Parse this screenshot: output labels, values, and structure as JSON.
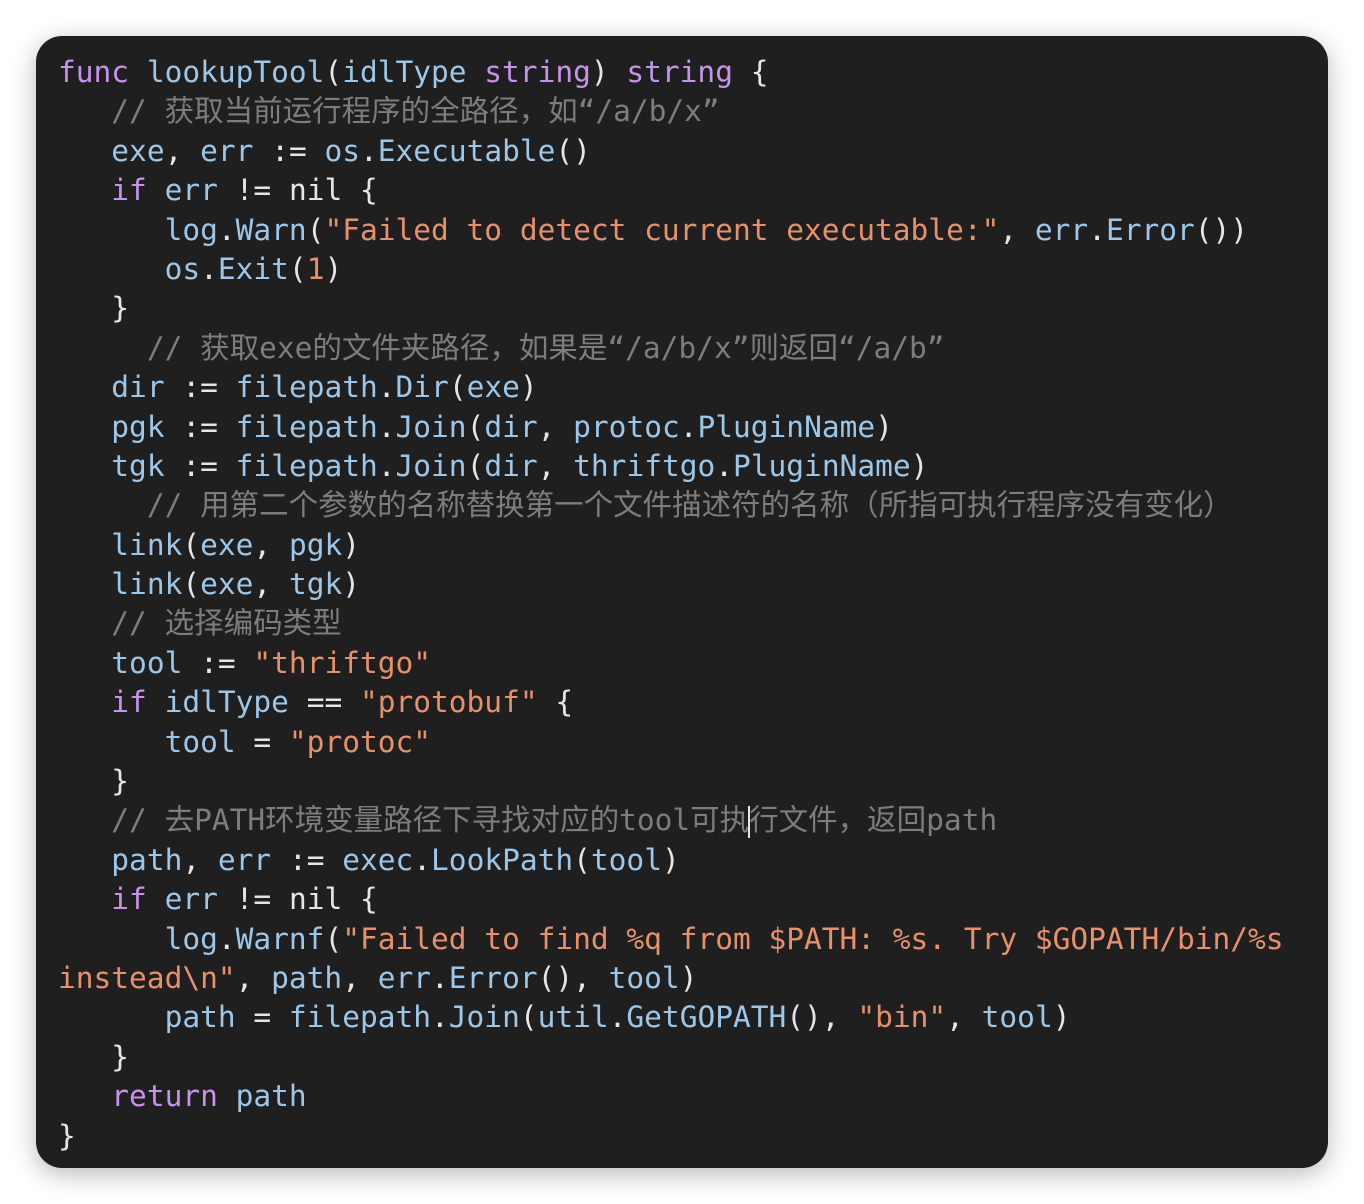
{
  "colors": {
    "background": "#1f1f1f",
    "keyword": "#c792ea",
    "identifier": "#9cc7e8",
    "string": "#e8906b",
    "comment": "#7d7d7d",
    "punctuation": "#e6e6e6"
  },
  "code": {
    "lines": [
      [
        [
          "kw",
          "func"
        ],
        [
          "pn",
          " "
        ],
        [
          "fn",
          "lookupTool"
        ],
        [
          "pn",
          "("
        ],
        [
          "id",
          "idlType"
        ],
        [
          "pn",
          " "
        ],
        [
          "ty",
          "string"
        ],
        [
          "pn",
          ") "
        ],
        [
          "ty",
          "string"
        ],
        [
          "pn",
          " {"
        ]
      ],
      [
        [
          "pn",
          "   "
        ],
        [
          "cm",
          "// 获取当前运行程序的全路径，如“/a/b/x”"
        ]
      ],
      [
        [
          "pn",
          "   "
        ],
        [
          "id",
          "exe"
        ],
        [
          "pn",
          ", "
        ],
        [
          "id",
          "err"
        ],
        [
          "pn",
          " "
        ],
        [
          "op",
          ":="
        ],
        [
          "pn",
          " "
        ],
        [
          "id",
          "os"
        ],
        [
          "pn",
          "."
        ],
        [
          "fn",
          "Executable"
        ],
        [
          "pn",
          "()"
        ]
      ],
      [
        [
          "pn",
          "   "
        ],
        [
          "kw",
          "if"
        ],
        [
          "pn",
          " "
        ],
        [
          "id",
          "err"
        ],
        [
          "pn",
          " "
        ],
        [
          "op",
          "!="
        ],
        [
          "pn",
          " nil {"
        ]
      ],
      [
        [
          "pn",
          "      "
        ],
        [
          "id",
          "log"
        ],
        [
          "pn",
          "."
        ],
        [
          "fn",
          "Warn"
        ],
        [
          "pn",
          "("
        ],
        [
          "str",
          "\"Failed to detect current executable:\""
        ],
        [
          "pn",
          ", "
        ],
        [
          "id",
          "err"
        ],
        [
          "pn",
          "."
        ],
        [
          "fn",
          "Error"
        ],
        [
          "pn",
          "())"
        ]
      ],
      [
        [
          "pn",
          "      "
        ],
        [
          "id",
          "os"
        ],
        [
          "pn",
          "."
        ],
        [
          "fn",
          "Exit"
        ],
        [
          "pn",
          "("
        ],
        [
          "num",
          "1"
        ],
        [
          "pn",
          ")"
        ]
      ],
      [
        [
          "pn",
          "   }"
        ]
      ],
      [
        [
          "pn",
          "     "
        ],
        [
          "cm",
          "// 获取exe的文件夹路径，如果是“/a/b/x”则返回“/a/b”"
        ]
      ],
      [
        [
          "pn",
          "   "
        ],
        [
          "id",
          "dir"
        ],
        [
          "pn",
          " "
        ],
        [
          "op",
          ":="
        ],
        [
          "pn",
          " "
        ],
        [
          "id",
          "filepath"
        ],
        [
          "pn",
          "."
        ],
        [
          "fn",
          "Dir"
        ],
        [
          "pn",
          "("
        ],
        [
          "id",
          "exe"
        ],
        [
          "pn",
          ")"
        ]
      ],
      [
        [
          "pn",
          "   "
        ],
        [
          "id",
          "pgk"
        ],
        [
          "pn",
          " "
        ],
        [
          "op",
          ":="
        ],
        [
          "pn",
          " "
        ],
        [
          "id",
          "filepath"
        ],
        [
          "pn",
          "."
        ],
        [
          "fn",
          "Join"
        ],
        [
          "pn",
          "("
        ],
        [
          "id",
          "dir"
        ],
        [
          "pn",
          ", "
        ],
        [
          "id",
          "protoc"
        ],
        [
          "pn",
          "."
        ],
        [
          "id",
          "PluginName"
        ],
        [
          "pn",
          ")"
        ]
      ],
      [
        [
          "pn",
          "   "
        ],
        [
          "id",
          "tgk"
        ],
        [
          "pn",
          " "
        ],
        [
          "op",
          ":="
        ],
        [
          "pn",
          " "
        ],
        [
          "id",
          "filepath"
        ],
        [
          "pn",
          "."
        ],
        [
          "fn",
          "Join"
        ],
        [
          "pn",
          "("
        ],
        [
          "id",
          "dir"
        ],
        [
          "pn",
          ", "
        ],
        [
          "id",
          "thriftgo"
        ],
        [
          "pn",
          "."
        ],
        [
          "id",
          "PluginName"
        ],
        [
          "pn",
          ")"
        ]
      ],
      [
        [
          "pn",
          "     "
        ],
        [
          "cm",
          "// 用第二个参数的名称替换第一个文件描述符的名称（所指可执行程序没有变化）"
        ]
      ],
      [
        [
          "pn",
          "   "
        ],
        [
          "fn",
          "link"
        ],
        [
          "pn",
          "("
        ],
        [
          "id",
          "exe"
        ],
        [
          "pn",
          ", "
        ],
        [
          "id",
          "pgk"
        ],
        [
          "pn",
          ")"
        ]
      ],
      [
        [
          "pn",
          "   "
        ],
        [
          "fn",
          "link"
        ],
        [
          "pn",
          "("
        ],
        [
          "id",
          "exe"
        ],
        [
          "pn",
          ", "
        ],
        [
          "id",
          "tgk"
        ],
        [
          "pn",
          ")"
        ]
      ],
      [
        [
          "pn",
          "   "
        ],
        [
          "cm",
          "// 选择编码类型"
        ]
      ],
      [
        [
          "pn",
          "   "
        ],
        [
          "id",
          "tool"
        ],
        [
          "pn",
          " "
        ],
        [
          "op",
          ":="
        ],
        [
          "pn",
          " "
        ],
        [
          "str",
          "\"thriftgo\""
        ]
      ],
      [
        [
          "pn",
          "   "
        ],
        [
          "kw",
          "if"
        ],
        [
          "pn",
          " "
        ],
        [
          "id",
          "idlType"
        ],
        [
          "pn",
          " "
        ],
        [
          "op",
          "=="
        ],
        [
          "pn",
          " "
        ],
        [
          "str",
          "\"protobuf\""
        ],
        [
          "pn",
          " {"
        ]
      ],
      [
        [
          "pn",
          "      "
        ],
        [
          "id",
          "tool"
        ],
        [
          "pn",
          " "
        ],
        [
          "op",
          "="
        ],
        [
          "pn",
          " "
        ],
        [
          "str",
          "\"protoc\""
        ]
      ],
      [
        [
          "pn",
          "   }"
        ]
      ],
      [
        [
          "pn",
          "   "
        ],
        [
          "cm",
          "// 去PATH环境变量路径下寻找对应的tool可执"
        ],
        [
          "cursor",
          ""
        ],
        [
          "cm",
          "行文件，返回path"
        ]
      ],
      [
        [
          "pn",
          "   "
        ],
        [
          "id",
          "path"
        ],
        [
          "pn",
          ", "
        ],
        [
          "id",
          "err"
        ],
        [
          "pn",
          " "
        ],
        [
          "op",
          ":="
        ],
        [
          "pn",
          " "
        ],
        [
          "id",
          "exec"
        ],
        [
          "pn",
          "."
        ],
        [
          "fn",
          "LookPath"
        ],
        [
          "pn",
          "("
        ],
        [
          "id",
          "tool"
        ],
        [
          "pn",
          ")"
        ]
      ],
      [
        [
          "pn",
          "   "
        ],
        [
          "kw",
          "if"
        ],
        [
          "pn",
          " "
        ],
        [
          "id",
          "err"
        ],
        [
          "pn",
          " "
        ],
        [
          "op",
          "!="
        ],
        [
          "pn",
          " nil {"
        ]
      ],
      [
        [
          "pn",
          "      "
        ],
        [
          "id",
          "log"
        ],
        [
          "pn",
          "."
        ],
        [
          "fn",
          "Warnf"
        ],
        [
          "pn",
          "("
        ],
        [
          "str",
          "\"Failed to find %q from $PATH: %s. Try $GOPATH/bin/%s"
        ]
      ],
      [
        [
          "str",
          "instead\\n\""
        ],
        [
          "pn",
          ", "
        ],
        [
          "id",
          "path"
        ],
        [
          "pn",
          ", "
        ],
        [
          "id",
          "err"
        ],
        [
          "pn",
          "."
        ],
        [
          "fn",
          "Error"
        ],
        [
          "pn",
          "(), "
        ],
        [
          "id",
          "tool"
        ],
        [
          "pn",
          ")"
        ]
      ],
      [
        [
          "pn",
          "      "
        ],
        [
          "id",
          "path"
        ],
        [
          "pn",
          " "
        ],
        [
          "op",
          "="
        ],
        [
          "pn",
          " "
        ],
        [
          "id",
          "filepath"
        ],
        [
          "pn",
          "."
        ],
        [
          "fn",
          "Join"
        ],
        [
          "pn",
          "("
        ],
        [
          "id",
          "util"
        ],
        [
          "pn",
          "."
        ],
        [
          "fn",
          "GetGOPATH"
        ],
        [
          "pn",
          "(), "
        ],
        [
          "str",
          "\"bin\""
        ],
        [
          "pn",
          ", "
        ],
        [
          "id",
          "tool"
        ],
        [
          "pn",
          ")"
        ]
      ],
      [
        [
          "pn",
          "   }"
        ]
      ],
      [
        [
          "pn",
          "   "
        ],
        [
          "kw",
          "return"
        ],
        [
          "pn",
          " "
        ],
        [
          "id",
          "path"
        ]
      ],
      [
        [
          "pn",
          "}"
        ]
      ]
    ]
  }
}
